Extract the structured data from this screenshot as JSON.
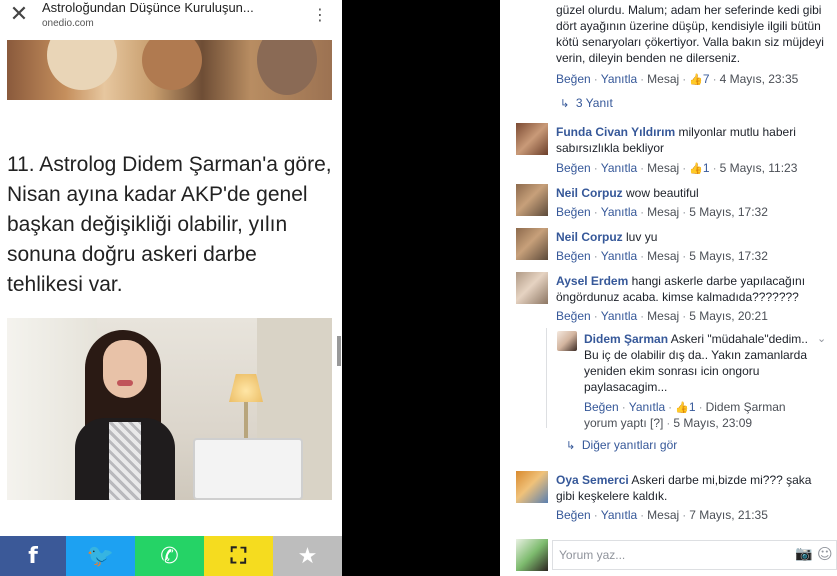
{
  "mobile": {
    "close_icon": "close-icon",
    "title": "Astroloğundan Düşünce Kuruluşun...",
    "domain": "onedio.com",
    "menu_icon": "more-vertical-icon",
    "article_heading": "11. Astrolog Didem Şarman'a göre, Nisan ayına kadar AKP'de genel başkan değişikliği olabilir, yılın sonuna doğru askeri darbe tehlikesi var.",
    "share": {
      "facebook": "f",
      "twitter": "🐦",
      "whatsapp": "✆",
      "expand": "⛶",
      "favorite": "★"
    },
    "colors": {
      "facebook": "#3b5998",
      "twitter": "#1da1f2",
      "whatsapp": "#25d366",
      "expand": "#f5dc1f",
      "favorite": "#bdbdbd"
    }
  },
  "comments": {
    "top_fragment": {
      "lines": [
        "güzel olurdu. Malum; adam her seferinde kedi gibi",
        "dört ayağının üzerine düşüp, kendisiyle ilgili bütün",
        "kötü senaryoları çökertiyor. Valla bakın siz müjdeyi",
        "verin, dileyin benden ne dilerseniz."
      ],
      "like": "Beğen",
      "reply": "Yanıtla",
      "message": "Mesaj",
      "likes": "7",
      "time": "4 Mayıs, 23:35",
      "replies_link": "3 Yanıt"
    },
    "items": [
      {
        "name": "Funda Civan Yıldırım",
        "text_line1": "milyonlar mutlu haberi",
        "text_line2": "sabırsızlıkla bekliyor",
        "like": "Beğen",
        "reply": "Yanıtla",
        "message": "Mesaj",
        "likes": "1",
        "time": "5 Mayıs, 11:23"
      },
      {
        "name": "Neil Corpuz",
        "text_line1": "wow beautiful",
        "like": "Beğen",
        "reply": "Yanıtla",
        "message": "Mesaj",
        "time": "5 Mayıs, 17:32"
      },
      {
        "name": "Neil Corpuz",
        "text_line1": "luv yu",
        "like": "Beğen",
        "reply": "Yanıtla",
        "message": "Mesaj",
        "time": "5 Mayıs, 17:32"
      },
      {
        "name": "Aysel Erdem",
        "text_line1": "hangi askerle darbe yapılacağını",
        "text_line2": "öngördunuz acaba. kimse kalmadıda???????",
        "like": "Beğen",
        "reply": "Yanıtla",
        "message": "Mesaj",
        "time": "5 Mayıs, 20:21"
      }
    ],
    "reply": {
      "name": "Didem Şarman",
      "lines": [
        "Askeri \"müdahale\"dedim..",
        "Bu iç de olabilir dış da.. Yakın zamanlarda",
        "yeniden ekim sonrası icin ongoru",
        "paylasacagim..."
      ],
      "like": "Beğen",
      "reply": "Yanıtla",
      "likes": "1",
      "posted_by": "Didem Şarman",
      "posted_by_line2": "yorum yaptı",
      "edit_mark": "[?]",
      "time": "5 Mayıs, 23:09",
      "more_link": "Diğer yanıtları gör"
    },
    "last": {
      "name": "Oya Semerci",
      "text_line1": "Askeri darbe mi,bizde mi??? şaka",
      "text_line2": "gibi keşkelere kaldık.",
      "like": "Beğen",
      "reply": "Yanıtla",
      "message": "Mesaj",
      "time": "7 Mayıs, 21:35"
    },
    "composer": {
      "placeholder": "Yorum yaz...",
      "camera_icon": "camera-icon",
      "emoji_icon": "smile-icon"
    }
  }
}
